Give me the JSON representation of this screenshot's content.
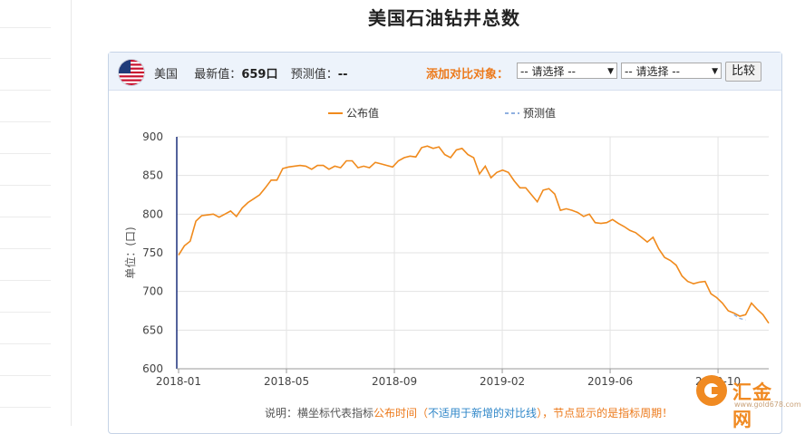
{
  "page_title": "美国石油钻井总数",
  "header": {
    "country": "美国",
    "latest_label": "最新值：",
    "latest_value": "659口",
    "forecast_label": "预测值：",
    "forecast_value": "--",
    "compare_label": "添加对比对象：",
    "select1": "-- 请选择 --",
    "select2": "-- 请选择 --",
    "compare_button": "比较"
  },
  "note": {
    "prefix": "说明：横坐标代表指标",
    "publish_time": "公布时间",
    "paren_open": "（",
    "not_applicable": "不适用于新增的对比线",
    "paren_close": "），节点显示的是",
    "period": "指标周期",
    "suffix": "！"
  },
  "logo": {
    "text": "汇金网",
    "url": "www.gold678.com"
  },
  "colors": {
    "line": "#f08a1c",
    "forecast": "#8fb0e0",
    "accent": "#ec7a1c",
    "link": "#2e86c8"
  },
  "chart_data": {
    "type": "line",
    "xlabel": "",
    "ylabel": "单位：(口)",
    "ylim": [
      600,
      900
    ],
    "yticks": [
      "600",
      "650",
      "700",
      "750",
      "800",
      "850",
      "900"
    ],
    "x_tick_labels": [
      "2018-01",
      "2018-05",
      "2018-09",
      "2019-02",
      "2019-06",
      "2019-10"
    ],
    "grid": true,
    "legend": {
      "position": "top",
      "entries": [
        "公布值",
        "预测值"
      ]
    },
    "series": [
      {
        "name": "公布值",
        "values": [
          747,
          759,
          765,
          791,
          798,
          799,
          800,
          796,
          800,
          804,
          797,
          808,
          815,
          820,
          825,
          834,
          844,
          844,
          859,
          861,
          862,
          863,
          862,
          858,
          863,
          863,
          858,
          862,
          860,
          869,
          869,
          860,
          862,
          860,
          867,
          865,
          863,
          861,
          869,
          873,
          875,
          874,
          886,
          888,
          885,
          887,
          877,
          873,
          883,
          885,
          877,
          873,
          852,
          862,
          847,
          854,
          857,
          854,
          843,
          834,
          834,
          825,
          816,
          831,
          833,
          826,
          805,
          807,
          805,
          802,
          797,
          800,
          789,
          788,
          789,
          793,
          788,
          784,
          779,
          776,
          770,
          764,
          770,
          755,
          744,
          740,
          734,
          720,
          713,
          710,
          712,
          713,
          697,
          692,
          685,
          675,
          672,
          668,
          670,
          685,
          677,
          670,
          659
        ]
      },
      {
        "name": "预测值",
        "values": [
          null,
          null,
          null,
          null,
          null,
          null,
          null,
          null,
          null,
          null,
          null,
          null,
          null,
          null,
          null,
          null,
          null,
          null,
          null,
          null,
          null,
          null,
          null,
          null,
          null,
          null,
          null,
          null,
          null,
          null,
          null,
          null,
          null,
          null,
          null,
          null,
          null,
          null,
          null,
          null,
          null,
          null,
          null,
          null,
          null,
          null,
          null,
          null,
          null,
          null,
          null,
          null,
          null,
          null,
          null,
          null,
          null,
          null,
          null,
          null,
          null,
          null,
          null,
          null,
          null,
          null,
          null,
          null,
          null,
          null,
          null,
          null,
          null,
          null,
          null,
          null,
          null,
          null,
          null,
          null,
          null,
          null,
          null,
          null,
          null,
          null,
          null,
          null,
          null,
          null,
          null,
          null,
          null,
          null,
          null,
          null,
          670,
          665,
          663,
          null,
          null,
          null,
          null
        ]
      }
    ]
  }
}
